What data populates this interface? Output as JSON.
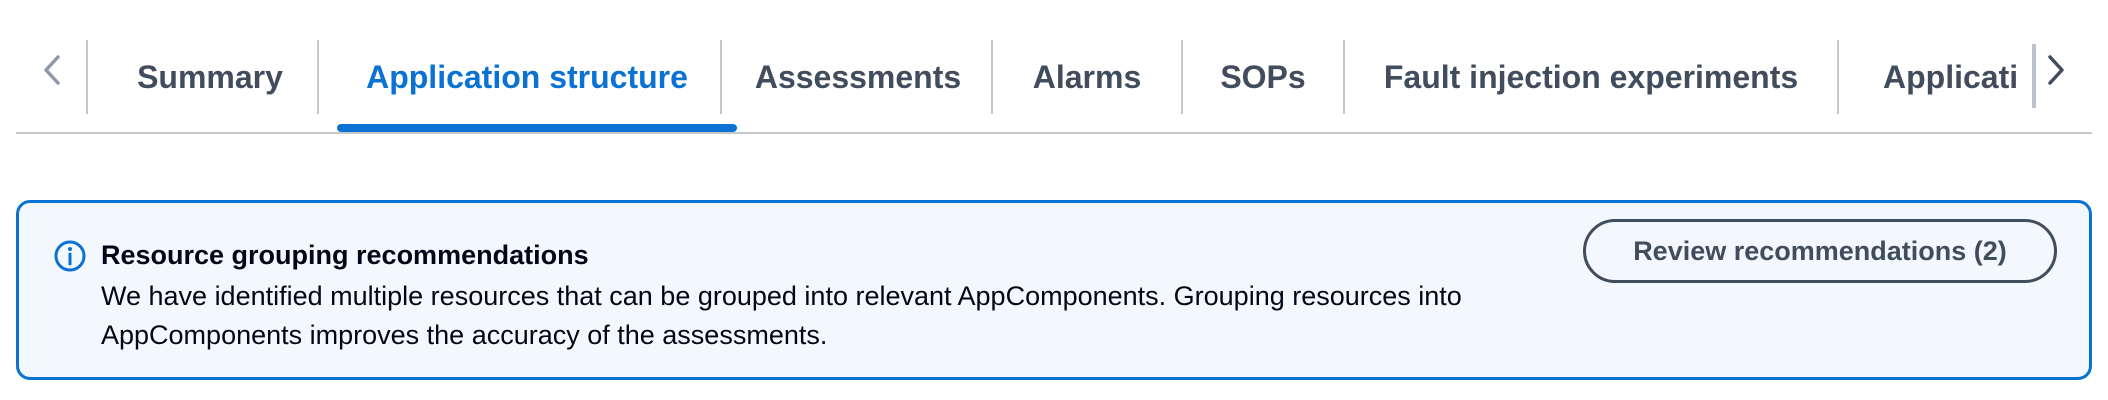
{
  "tabs": [
    {
      "label": "Summary"
    },
    {
      "label": "Application structure",
      "active": true
    },
    {
      "label": "Assessments"
    },
    {
      "label": "Alarms"
    },
    {
      "label": "SOPs"
    },
    {
      "label": "Fault injection experiments"
    },
    {
      "label": "Applicati"
    }
  ],
  "alert": {
    "title": "Resource grouping recommendations",
    "body": "We have identified multiple resources that can be grouped into relevant AppComponents. Grouping resources into AppComponents improves the accuracy of the assessments.",
    "action_label": "Review recommendations (2)",
    "icon": "info-icon"
  },
  "colors": {
    "accent": "#0972d3",
    "text_secondary": "#414d5c",
    "alert_bg": "#f2f8fd",
    "divider": "#c6c6cd"
  }
}
